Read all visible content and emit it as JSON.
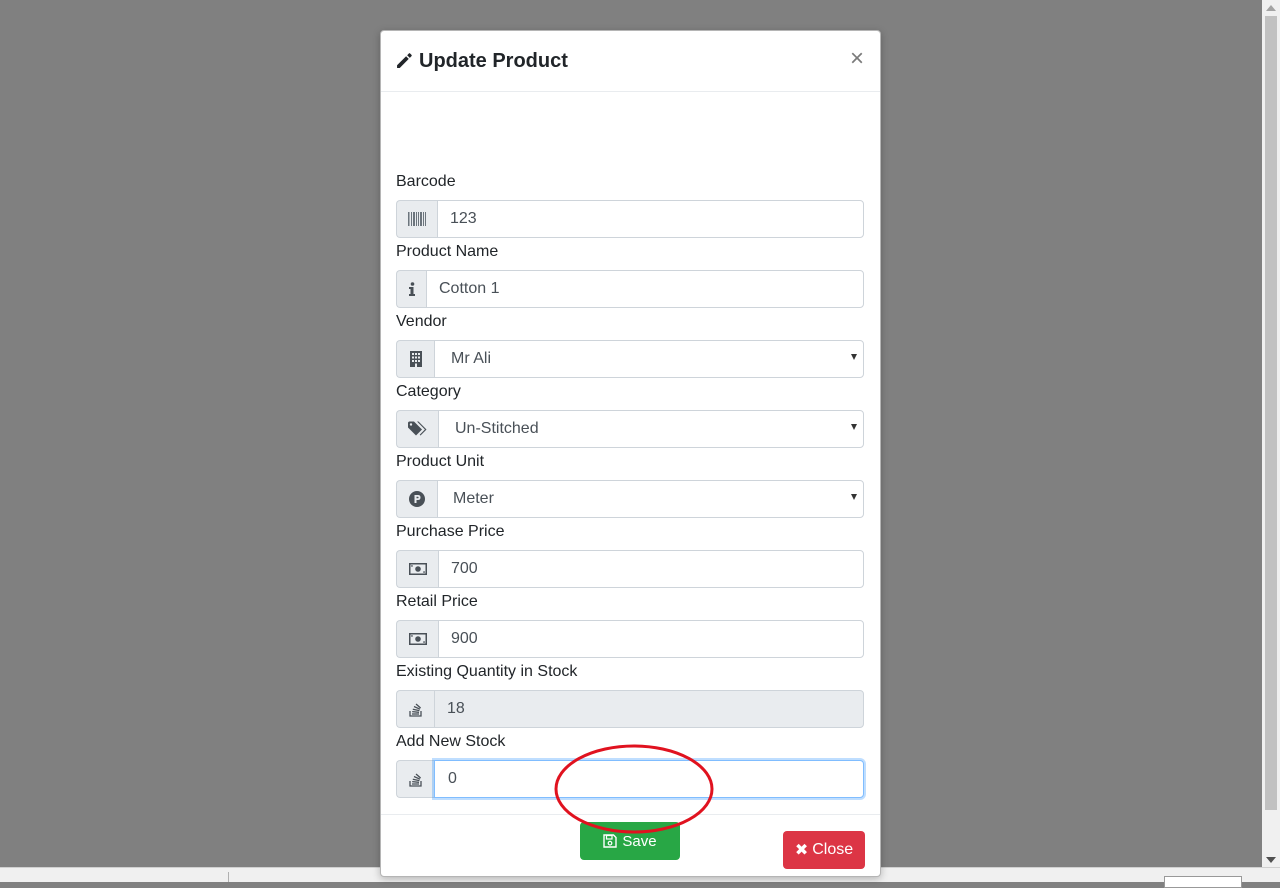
{
  "modal": {
    "title": "Update Product",
    "close_symbol": "×"
  },
  "fields": [
    {
      "label": "Barcode",
      "value": "123",
      "icon": "barcode-icon",
      "type": "text"
    },
    {
      "label": "Product Name",
      "value": "Cotton 1",
      "icon": "info-icon",
      "type": "text"
    },
    {
      "label": "Vendor",
      "value": "Mr Ali",
      "icon": "building-icon",
      "type": "select"
    },
    {
      "label": "Category",
      "value": "Un-Stitched",
      "icon": "tags-icon",
      "type": "select"
    },
    {
      "label": "Product Unit",
      "value": "Meter",
      "icon": "parking-icon",
      "type": "select"
    },
    {
      "label": "Purchase Price",
      "value": "700",
      "icon": "money-bill-icon",
      "type": "text"
    },
    {
      "label": "Retail Price",
      "value": "900",
      "icon": "money-bill-icon",
      "type": "text"
    },
    {
      "label": "Existing Quantity in Stock",
      "value": "18",
      "icon": "stack-overflow-icon",
      "type": "readonly"
    },
    {
      "label": "Add New Stock",
      "value": "0",
      "icon": "stack-overflow-icon",
      "type": "text",
      "focused": true
    }
  ],
  "buttons": {
    "save_label": "Save",
    "close_label": "Close",
    "close_icon_symbol": "✖"
  },
  "colors": {
    "save": "#28a745",
    "close": "#dc3545",
    "annotation": "#e0121f",
    "backdrop": "#808080"
  }
}
